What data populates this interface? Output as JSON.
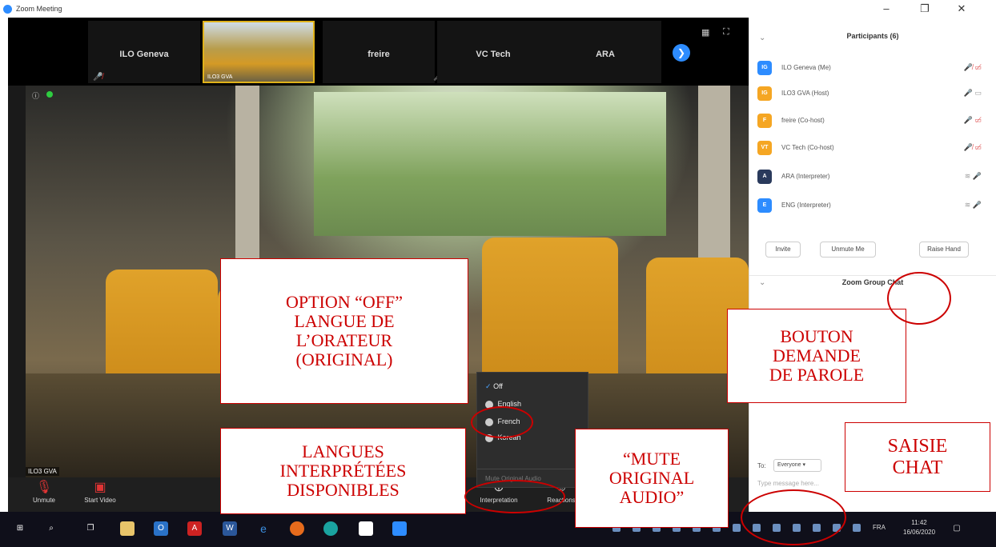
{
  "window": {
    "title": "Zoom Meeting",
    "minimize": "–",
    "maximize": "❐",
    "close": "✕"
  },
  "thumbnails": [
    {
      "name": "ILO Geneva",
      "muted": true
    },
    {
      "name": "ILO3 GVA",
      "photo": true
    },
    {
      "name": "freire",
      "muted": true
    },
    {
      "name": "VC Tech"
    },
    {
      "name": "ARA"
    }
  ],
  "next_icon": "❯",
  "main_video": {
    "participant": "ILO3 GVA",
    "info_icon": "ⓘ"
  },
  "toolbar": {
    "unmute": "Unmute",
    "start_video": "Start Video",
    "interpretation": "Interpretation",
    "reactions": "Reactions"
  },
  "interpretation_menu": {
    "options": [
      {
        "label": "Off",
        "checked": true
      },
      {
        "label": "English"
      },
      {
        "label": "French"
      },
      {
        "label": "Korean"
      }
    ],
    "mute_original": "Mute Original Audio"
  },
  "participants": {
    "title": "Participants (6)",
    "list": [
      {
        "initials": "IG",
        "name": "ILO Geneva (Me)",
        "color": "#2d8cff"
      },
      {
        "initials": "IG",
        "name": "ILO3 GVA (Host)",
        "color": "#f5a623"
      },
      {
        "initials": "F",
        "name": "freire (Co-host)",
        "color": "#f5a623"
      },
      {
        "initials": "VT",
        "name": "VC Tech (Co-host)",
        "color": "#f5a623"
      },
      {
        "initials": "A",
        "name": "ARA (Interpreter)",
        "color": "#2a3a5c"
      },
      {
        "initials": "E",
        "name": "ENG (Interpreter)",
        "color": "#2d8cff"
      }
    ],
    "buttons": {
      "invite": "Invite",
      "unmute_me": "Unmute Me",
      "raise_hand": "Raise Hand"
    }
  },
  "chat": {
    "title": "Zoom Group Chat",
    "to_label": "To:",
    "recipient": "Everyone ▾",
    "placeholder": "Type message here..."
  },
  "taskbar": {
    "language": "FRA",
    "time": "11:42",
    "date": "16/06/2020"
  },
  "annotations": {
    "option_off": "OPTION “OFF”\nLANGUE DE\nL’ORATEUR\n(ORIGINAL)",
    "languages": "LANGUES\nINTERPRÉTÉES\nDISPONIBLES",
    "mute_original": "“MUTE\nORIGINAL\nAUDIO”",
    "raise_hand": "BOUTON\nDEMANDE\nDE PAROLE",
    "chat_input": "SAISIE\nCHAT"
  }
}
